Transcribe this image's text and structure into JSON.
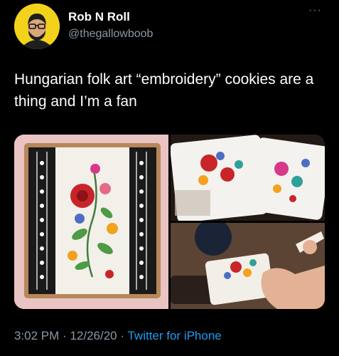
{
  "user": {
    "name": "Rob N Roll",
    "handle": "@thegallowboob"
  },
  "tweet": {
    "text": "Hungarian folk art “embroidery” cookies are a thing and I’m a fan",
    "time": "3:02 PM",
    "separator1": "·",
    "date": "12/26/20",
    "separator2": "·",
    "source": "Twitter for iPhone",
    "more_icon": "···"
  },
  "colors": {
    "background": "#000000",
    "avatar_bg": "#f2d21a",
    "meta_text": "#8b98a5",
    "link": "#1d9bf0"
  }
}
